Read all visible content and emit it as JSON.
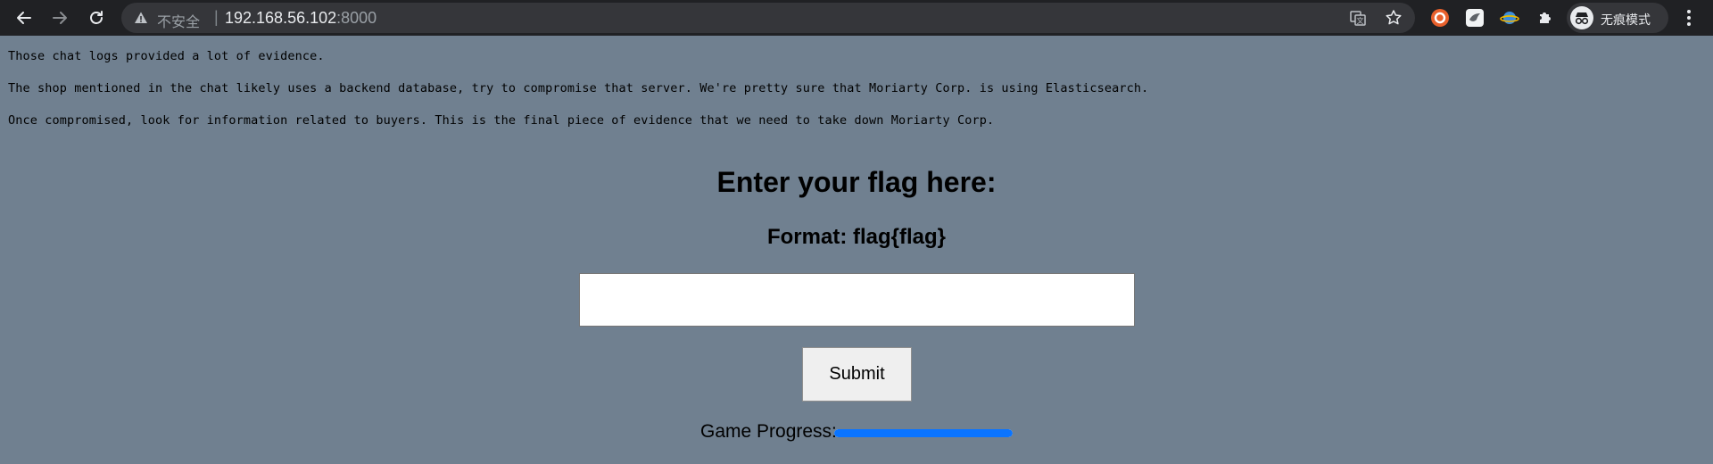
{
  "browser": {
    "insecure_label": "不安全",
    "url_host": "192.168.56.102",
    "url_port": ":8000",
    "profile_label": "无痕模式"
  },
  "messages": [
    "Those chat logs provided a lot of evidence.",
    "The shop mentioned in the chat likely uses a backend database, try to compromise that server. We're pretty sure that Moriarty Corp. is using Elasticsearch.",
    "Once compromised, look for information related to buyers. This is the final piece of evidence that we need to take down Moriarty Corp."
  ],
  "form": {
    "title": "Enter your flag here:",
    "format_text": "Format: flag{flag}",
    "input_value": "",
    "submit_label": "Submit"
  },
  "progress": {
    "label": "Game Progress:",
    "fraction": 1.0,
    "color": "#0a74ff"
  },
  "colors": {
    "page_background": "#708090",
    "chrome_background": "#202124"
  }
}
